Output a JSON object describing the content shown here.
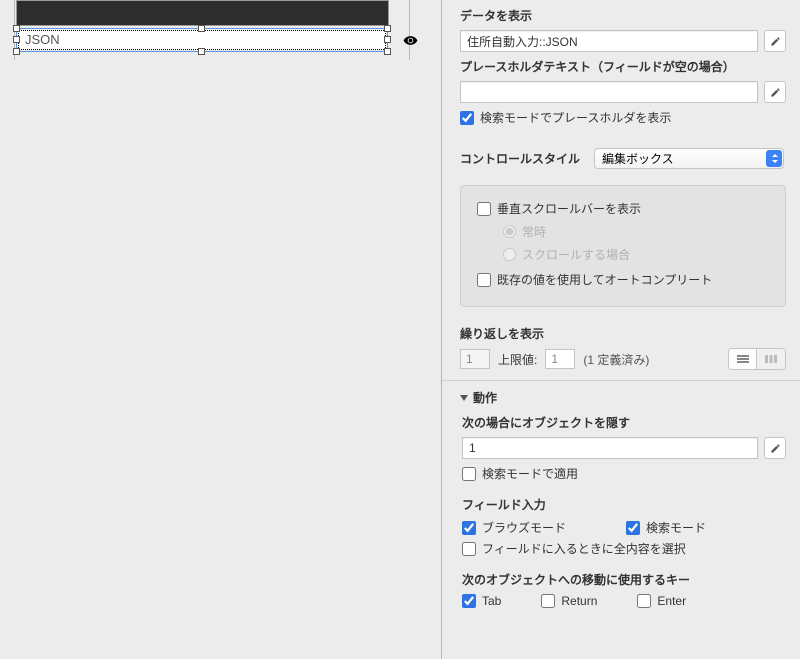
{
  "canvas": {
    "field_text": "JSON"
  },
  "inspector": {
    "data_display": {
      "label": "データを表示",
      "value": "住所自動入力::JSON"
    },
    "placeholder": {
      "label": "プレースホルダテキスト（フィールドが空の場合）",
      "value": "",
      "show_in_find_label": "検索モードでプレースホルダを表示",
      "show_in_find_checked": true
    },
    "control_style": {
      "label": "コントロールスタイル",
      "value": "編集ボックス"
    },
    "scroll_panel": {
      "vscroll_label": "垂直スクロールバーを表示",
      "vscroll_checked": false,
      "always_label": "常時",
      "on_scroll_label": "スクロールする場合",
      "autocomplete_label": "既存の値を使用してオートコンプリート",
      "autocomplete_checked": false
    },
    "repetition": {
      "label": "繰り返しを表示",
      "start_value": "1",
      "max_label": "上限値:",
      "max_value": "1",
      "defined_text": "(1 定義済み)"
    },
    "behavior": {
      "header": "動作",
      "hide_label": "次の場合にオブジェクトを隠す",
      "hide_value": "1",
      "apply_find_label": "検索モードで適用",
      "apply_find_checked": false,
      "field_entry_label": "フィールド入力",
      "browse_label": "ブラウズモード",
      "browse_checked": true,
      "find_label": "検索モード",
      "find_checked": true,
      "select_all_label": "フィールドに入るときに全内容を選択",
      "select_all_checked": false,
      "next_key_label": "次のオブジェクトへの移動に使用するキー",
      "tab_label": "Tab",
      "tab_checked": true,
      "return_label": "Return",
      "return_checked": false,
      "enter_label": "Enter",
      "enter_checked": false
    }
  }
}
